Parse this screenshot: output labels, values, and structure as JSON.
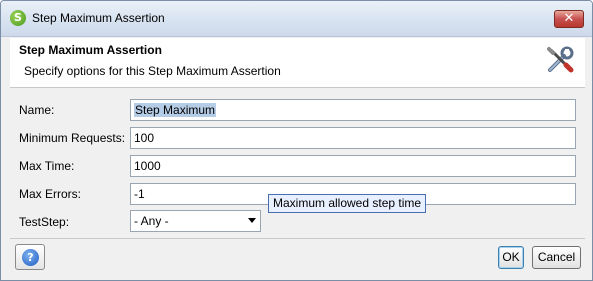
{
  "window": {
    "title": "Step Maximum Assertion",
    "app_icon_letter": "S",
    "close_glyph": "✕"
  },
  "header": {
    "title": "Step Maximum Assertion",
    "description": "Specify options for this Step Maximum Assertion",
    "icon": "tools-icon"
  },
  "form": {
    "fields": [
      {
        "label": "Name:",
        "value": "Step Maximum"
      },
      {
        "label": "Minimum Requests:",
        "value": "100"
      },
      {
        "label": "Max Time:",
        "value": "1000"
      },
      {
        "label": "Max Errors:",
        "value": "-1"
      }
    ],
    "teststep": {
      "label": "TestStep:",
      "selected": "- Any -"
    }
  },
  "tooltip": {
    "text": "Maximum allowed step time"
  },
  "footer": {
    "help_glyph": "?",
    "ok_label": "OK",
    "cancel_label": "Cancel"
  },
  "colors": {
    "accent": "#3c7fb1",
    "selection": "#b5cce6",
    "tooltip_bg": "#e8efff",
    "close": "#c75050"
  }
}
